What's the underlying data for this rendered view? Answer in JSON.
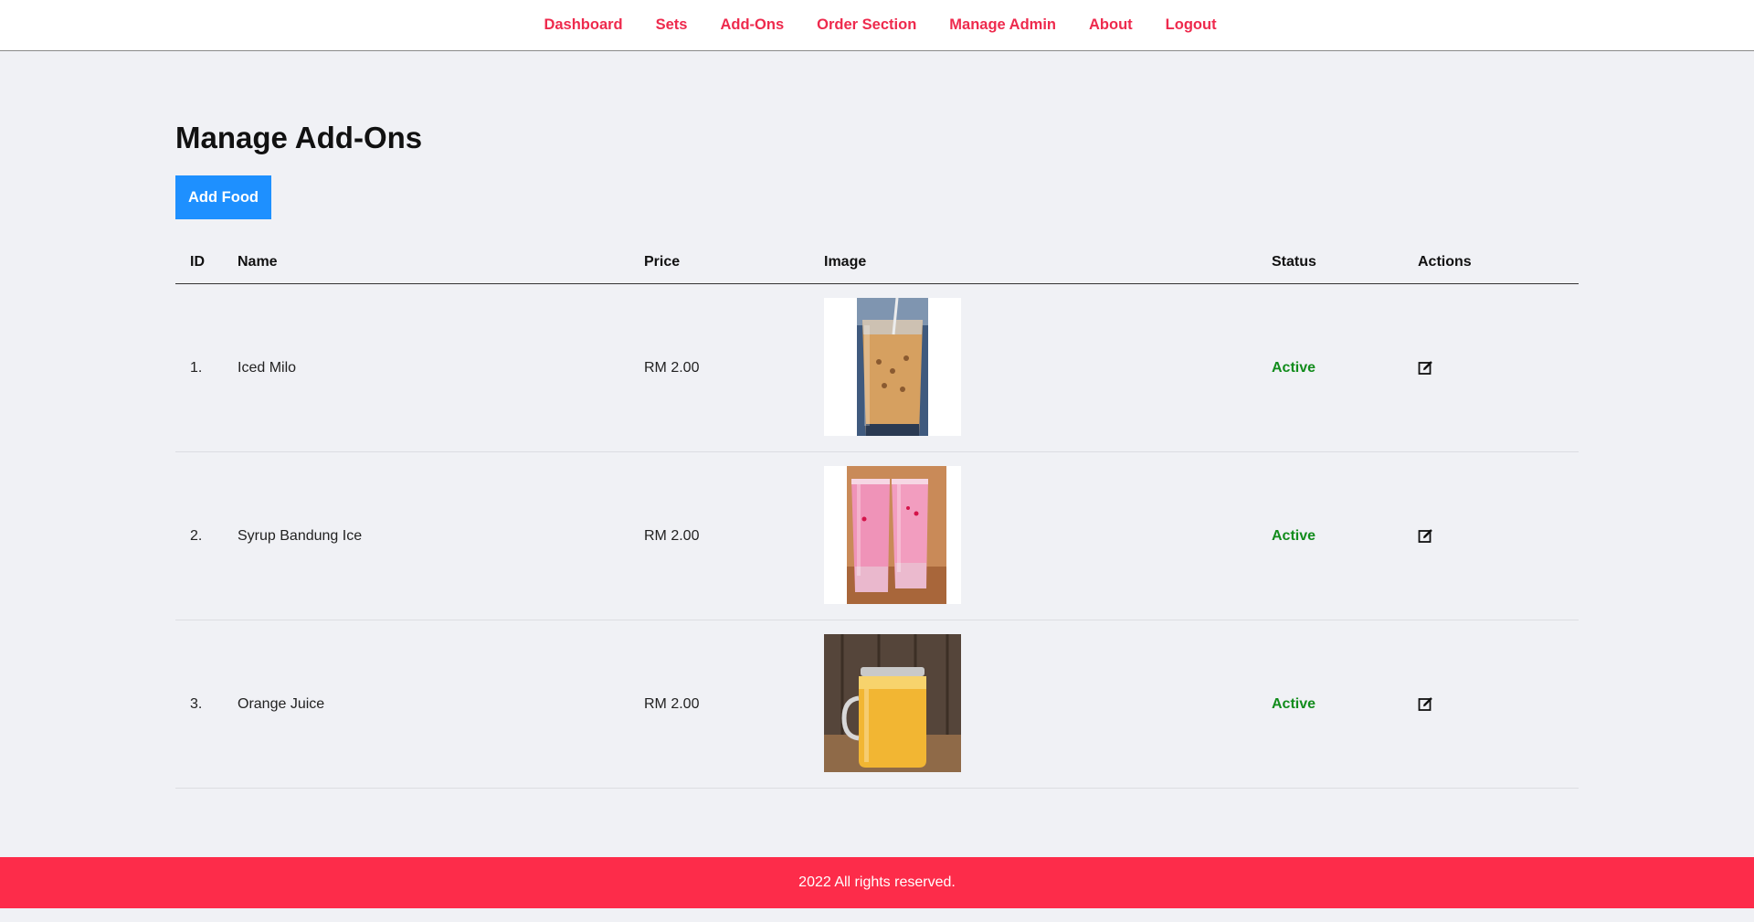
{
  "nav": {
    "items": [
      {
        "label": "Dashboard"
      },
      {
        "label": "Sets"
      },
      {
        "label": "Add-Ons"
      },
      {
        "label": "Order Section"
      },
      {
        "label": "Manage Admin"
      },
      {
        "label": "About"
      },
      {
        "label": "Logout"
      }
    ]
  },
  "page": {
    "title": "Manage Add-Ons",
    "add_button_label": "Add Food"
  },
  "table": {
    "headers": {
      "id": "ID",
      "name": "Name",
      "price": "Price",
      "image": "Image",
      "status": "Status",
      "actions": "Actions"
    },
    "rows": [
      {
        "id": "1.",
        "name": "Iced Milo",
        "price": "RM 2.00",
        "image": "iced-milo-photo",
        "status": "Active",
        "action_icon": "edit-icon"
      },
      {
        "id": "2.",
        "name": "Syrup Bandung Ice",
        "price": "RM 2.00",
        "image": "syrup-bandung-photo",
        "status": "Active",
        "action_icon": "edit-icon"
      },
      {
        "id": "3.",
        "name": "Orange Juice",
        "price": "RM 2.00",
        "image": "orange-juice-photo",
        "status": "Active",
        "action_icon": "edit-icon"
      }
    ]
  },
  "footer": {
    "text": "2022 All rights reserved."
  },
  "colors": {
    "nav_link": "#ee2a4d",
    "primary_button": "#1e90ff",
    "status_active": "#128c1c",
    "footer": "#fd2c4a",
    "background": "#f0f1f5"
  }
}
